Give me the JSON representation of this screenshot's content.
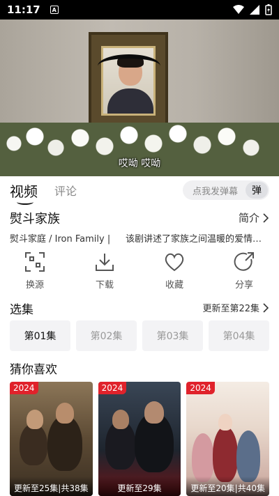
{
  "status_bar": {
    "time": "11:17",
    "notification_glyph": "A"
  },
  "video": {
    "subtitle": "哎呦 哎呦"
  },
  "tabs": {
    "video": "视频",
    "comment": "评论"
  },
  "danmu": {
    "placeholder": "点我发弹幕",
    "button": "弹"
  },
  "show": {
    "title": "熨斗家族",
    "intro_label": "简介",
    "meta_left": "熨斗家庭 / Iron Family |",
    "meta_right": "该剧讲述了家族之间温暖的爱情…"
  },
  "actions": [
    {
      "label": "换源",
      "icon": "scan-icon"
    },
    {
      "label": "下载",
      "icon": "download-icon"
    },
    {
      "label": "收藏",
      "icon": "heart-icon"
    },
    {
      "label": "分享",
      "icon": "share-icon"
    }
  ],
  "episodes": {
    "title": "选集",
    "update_text": "更新至第22集",
    "items": [
      "第01集",
      "第02集",
      "第03集",
      "第04集"
    ],
    "selected": "第01集"
  },
  "recommend": {
    "title": "猜你喜欢",
    "cards": [
      {
        "year": "2024",
        "caption": "更新至25集|共38集"
      },
      {
        "year": "2024",
        "caption": "更新至29集"
      },
      {
        "year": "2024",
        "caption": "更新至20集|共40集"
      }
    ]
  },
  "colors": {
    "badge": "#e0222b",
    "episode_bg": "#f3f3f5"
  }
}
